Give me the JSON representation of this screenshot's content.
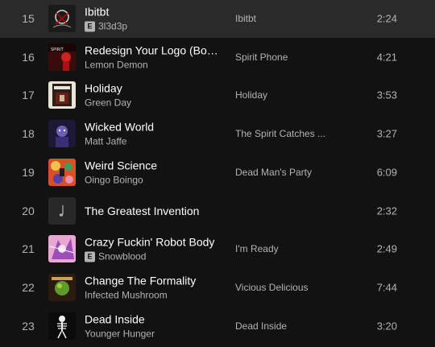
{
  "tracks": [
    {
      "num": "15",
      "title": "Ibitbt",
      "explicit": true,
      "explicit_label": "E",
      "artist": "3l3d3p",
      "album": "Ibitbt",
      "duration": "2:24",
      "cover_icon": "album-cover-dark-graffiti"
    },
    {
      "num": "16",
      "title": "Redesign Your Logo (Bon...",
      "explicit": false,
      "artist": "Lemon Demon",
      "album": "Spirit Phone",
      "duration": "4:21",
      "cover_icon": "album-cover-red-figure"
    },
    {
      "num": "17",
      "title": "Holiday",
      "explicit": false,
      "artist": "Green Day",
      "album": "Holiday",
      "duration": "3:53",
      "cover_icon": "album-cover-green-day"
    },
    {
      "num": "18",
      "title": "Wicked World",
      "explicit": false,
      "artist": "Matt Jaffe",
      "album": "The Spirit Catches ...",
      "duration": "3:27",
      "cover_icon": "album-cover-purple-portrait"
    },
    {
      "num": "19",
      "title": "Weird Science",
      "explicit": false,
      "artist": "Oingo Boingo",
      "album": "Dead Man's Party",
      "duration": "6:09",
      "cover_icon": "album-cover-colorful-pattern"
    },
    {
      "num": "20",
      "title": "The Greatest Invention",
      "explicit": false,
      "artist": "",
      "album": "",
      "duration": "2:32",
      "cover_icon": "music-note-placeholder-icon"
    },
    {
      "num": "21",
      "title": "Crazy Fuckin' Robot Body",
      "explicit": true,
      "explicit_label": "E",
      "artist": "Snowblood",
      "album": "I'm Ready",
      "duration": "2:49",
      "cover_icon": "album-cover-pink-anime"
    },
    {
      "num": "22",
      "title": "Change The Formality",
      "explicit": false,
      "artist": "Infected Mushroom",
      "album": "Vicious Delicious",
      "duration": "7:44",
      "cover_icon": "album-cover-green-orb"
    },
    {
      "num": "23",
      "title": "Dead Inside",
      "explicit": false,
      "artist": "Younger Hunger",
      "album": "Dead Inside",
      "duration": "3:20",
      "cover_icon": "album-cover-skeleton"
    }
  ],
  "colors": {
    "background": "#121212",
    "text_primary": "#ffffff",
    "text_secondary": "#b3b3b3"
  }
}
